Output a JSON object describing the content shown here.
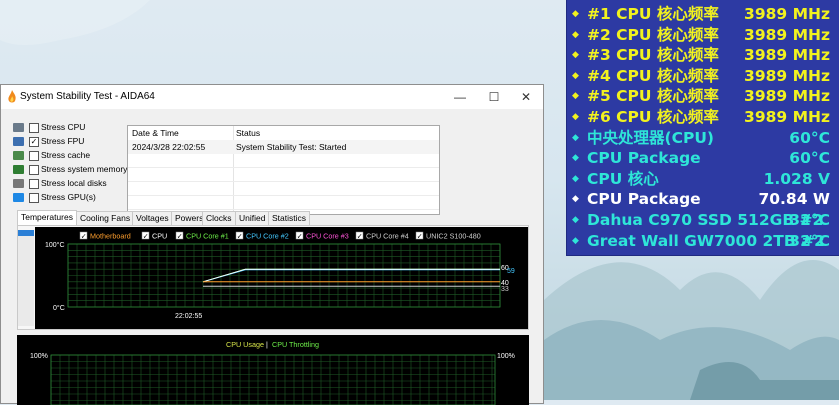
{
  "osd": {
    "rows": [
      {
        "label": "#1 CPU 核心频率",
        "value": "3989 MHz",
        "color": "#f2f21e"
      },
      {
        "label": "#2 CPU 核心频率",
        "value": "3989 MHz",
        "color": "#f2f21e"
      },
      {
        "label": "#3 CPU 核心频率",
        "value": "3989 MHz",
        "color": "#f2f21e"
      },
      {
        "label": "#4 CPU 核心频率",
        "value": "3989 MHz",
        "color": "#f2f21e"
      },
      {
        "label": "#5 CPU 核心频率",
        "value": "3989 MHz",
        "color": "#f2f21e"
      },
      {
        "label": "#6 CPU 核心频率",
        "value": "3989 MHz",
        "color": "#f2f21e"
      },
      {
        "label": "中央处理器(CPU)",
        "value": "60°C",
        "color": "#2ee6d8"
      },
      {
        "label": "CPU Package",
        "value": "60°C",
        "color": "#2ee6d8"
      },
      {
        "label": "CPU 核心",
        "value": "1.028 V",
        "color": "#2ee6d8"
      },
      {
        "label": "CPU Package",
        "value": "70.84 W",
        "color": "#ffffff"
      },
      {
        "label": "Dahua C970 SSD 512GB #2",
        "value": "32°C",
        "color": "#2ee6d8"
      },
      {
        "label": "Great Wall GW7000  2TB #2",
        "value": "32°C",
        "color": "#2ee6d8"
      }
    ]
  },
  "window": {
    "title": "System Stability Test - AIDA64",
    "minimize": "—",
    "maximize": "☐",
    "close": "✕"
  },
  "stress": [
    {
      "label": "Stress CPU",
      "checked": false
    },
    {
      "label": "Stress FPU",
      "checked": true
    },
    {
      "label": "Stress cache",
      "checked": false
    },
    {
      "label": "Stress system memory",
      "checked": false
    },
    {
      "label": "Stress local disks",
      "checked": false
    },
    {
      "label": "Stress GPU(s)",
      "checked": false
    }
  ],
  "log": {
    "col_date": "Date & Time",
    "col_status": "Status",
    "rows": [
      {
        "date": "2024/3/28 22:02:55",
        "status": "System Stability Test: Started"
      }
    ]
  },
  "tabs": [
    "Temperatures",
    "Cooling Fans",
    "Voltages",
    "Powers",
    "Clocks",
    "Unified",
    "Statistics"
  ],
  "chart_data": [
    {
      "type": "line",
      "legend": [
        {
          "name": "Motherboard",
          "color": "#ff9f2e",
          "checked": true
        },
        {
          "name": "CPU",
          "color": "#ffffff",
          "checked": true
        },
        {
          "name": "CPU Core #1",
          "color": "#6ef04a",
          "checked": true
        },
        {
          "name": "CPU Core #2",
          "color": "#44c9ff",
          "checked": true
        },
        {
          "name": "CPU Core #3",
          "color": "#ff54d8",
          "checked": true
        },
        {
          "name": "CPU Core #4",
          "color": "#cfcfcf",
          "checked": true
        },
        {
          "name": "UNIC2 S100-480",
          "color": "#cfcfcf",
          "checked": true
        }
      ],
      "y_top_label": "100°C",
      "y_bottom_label": "0°C",
      "ylim": [
        0,
        100
      ],
      "x_label": "22:02:55",
      "series": [
        {
          "name": "CPU Core #1",
          "color": "#6ef04a",
          "values": [
            40,
            40,
            40,
            60,
            60,
            60,
            60,
            60,
            60,
            60
          ]
        },
        {
          "name": "CPU Core #2",
          "color": "#44c9ff",
          "values": [
            40,
            40,
            40,
            59,
            59,
            59,
            59,
            59,
            59,
            59
          ]
        },
        {
          "name": "CPU",
          "color": "#ffffff",
          "values": [
            40,
            40,
            40,
            60,
            60,
            60,
            60,
            60,
            60,
            60
          ]
        },
        {
          "name": "Motherboard",
          "color": "#ff9f2e",
          "values": [
            40,
            40,
            40,
            40,
            40,
            40,
            40,
            40,
            40,
            40
          ]
        },
        {
          "name": "UNIC2 S100-480",
          "color": "#cfcfcf",
          "values": [
            33,
            33,
            33,
            33,
            33,
            33,
            33,
            33,
            33,
            33
          ]
        }
      ],
      "right_labels": [
        "60",
        "59",
        "40",
        "33"
      ]
    },
    {
      "type": "line",
      "legend": [
        {
          "name": "CPU Usage",
          "color": "#d8e64a"
        },
        {
          "name": "CPU Throttling",
          "color": "#6ef04a"
        }
      ],
      "y_top_label": "100%",
      "y_top_label_right": "100%",
      "ylim": [
        0,
        100
      ]
    }
  ]
}
